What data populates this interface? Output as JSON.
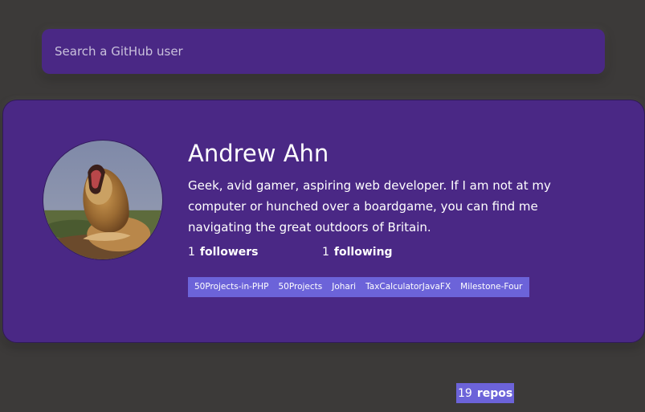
{
  "search": {
    "placeholder": "Search a GitHub user"
  },
  "profile": {
    "name": "Andrew Ahn",
    "bio": "Geek, avid gamer, aspiring web developer. If I am not at my computer or hunched over a boardgame, you can find me navigating the great outdoors of Britain.",
    "avatar_icon": "lion-avatar-image",
    "stats": {
      "followers": {
        "count": "1",
        "label": "followers"
      },
      "following": {
        "count": "1",
        "label": "following"
      },
      "repos": {
        "count": "19",
        "label": "repos"
      }
    },
    "repos": [
      "50Projects-in-PHP",
      "50Projects",
      "Johari",
      "TaxCalculatorJavaFX",
      "Milestone-Four"
    ]
  },
  "colors": {
    "background": "#3c3a39",
    "card": "#4a2885",
    "repo_chip": "#6c63d9",
    "text": "#ffffff"
  }
}
